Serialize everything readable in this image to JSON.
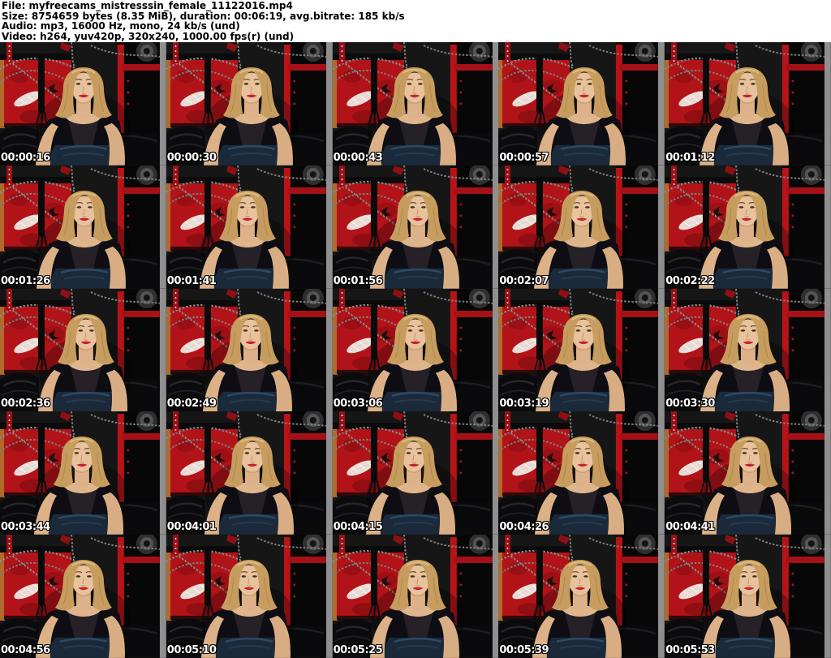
{
  "header": {
    "file_line": "File: myfreecams_mistresssin_female_11122016.mp4",
    "size_line": "Size: 8754659 bytes (8.35 MiB), duration: 00:06:19, avg.bitrate: 185 kb/s",
    "audio_line": "Audio: mp3, 16000 Hz, mono, 24 kb/s (und)",
    "video_line": "Video: h264, yuv420p, 320x240, 1000.00 fps(r) (und)"
  },
  "grid": {
    "rows": 5,
    "columns": 5
  },
  "thumbnails": [
    {
      "timestamp": "00:00:16"
    },
    {
      "timestamp": "00:00:30"
    },
    {
      "timestamp": "00:00:43"
    },
    {
      "timestamp": "00:00:57"
    },
    {
      "timestamp": "00:01:12"
    },
    {
      "timestamp": "00:01:26"
    },
    {
      "timestamp": "00:01:41"
    },
    {
      "timestamp": "00:01:56"
    },
    {
      "timestamp": "00:02:07"
    },
    {
      "timestamp": "00:02:22"
    },
    {
      "timestamp": "00:02:36"
    },
    {
      "timestamp": "00:02:49"
    },
    {
      "timestamp": "00:03:06"
    },
    {
      "timestamp": "00:03:19"
    },
    {
      "timestamp": "00:03:30"
    },
    {
      "timestamp": "00:03:44"
    },
    {
      "timestamp": "00:04:01"
    },
    {
      "timestamp": "00:04:15"
    },
    {
      "timestamp": "00:04:26"
    },
    {
      "timestamp": "00:04:41"
    },
    {
      "timestamp": "00:04:56"
    },
    {
      "timestamp": "00:05:10"
    },
    {
      "timestamp": "00:05:25"
    },
    {
      "timestamp": "00:05:39"
    },
    {
      "timestamp": "00:05:53"
    }
  ],
  "colors": {
    "header_bg": "#ffffff",
    "header_text": "#000000",
    "timestamp_text": "#ffffff",
    "timestamp_outline": "#000000",
    "panel_red": "#b21318",
    "shelf_red": "#b81418",
    "wall_black": "#161616",
    "curtain_gray": "#8f8f8f",
    "hair_blonde": "#c79d5f",
    "skin": "#e8c29c"
  }
}
